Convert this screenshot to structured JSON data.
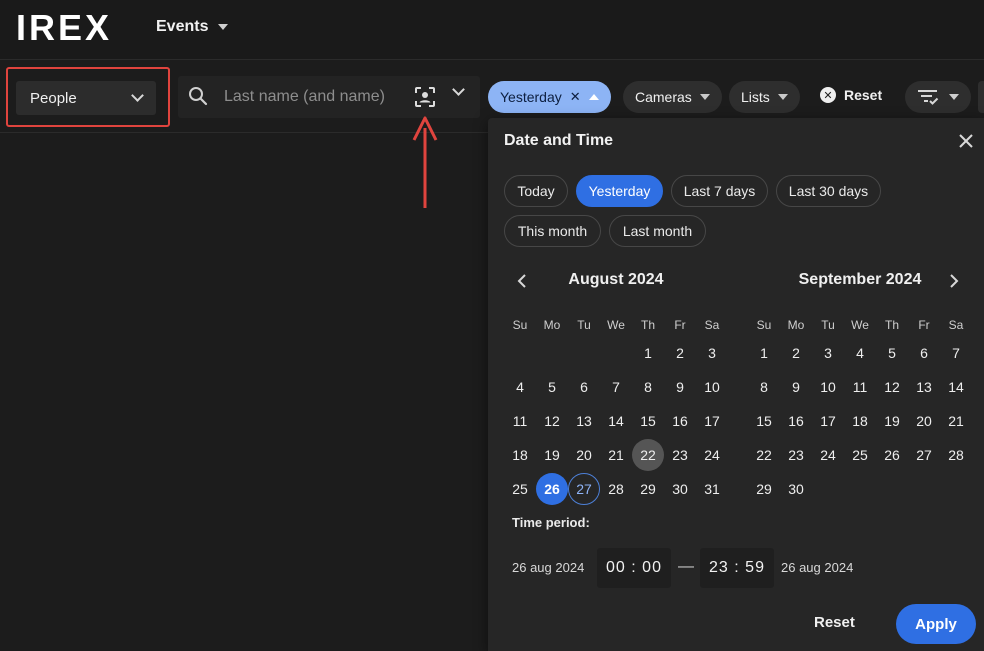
{
  "app": {
    "logo": "IREX",
    "nav_label": "Events"
  },
  "filterbar": {
    "object_type": "People",
    "search_placeholder": "Last name (and name)",
    "chips": {
      "date": "Yesterday",
      "cameras": "Cameras",
      "lists": "Lists"
    },
    "reset_label": "Reset"
  },
  "panel": {
    "title": "Date and Time",
    "presets": [
      "Today",
      "Yesterday",
      "Last 7 days",
      "Last 30 days",
      "This month",
      "Last month"
    ],
    "selected_preset": "Yesterday",
    "weekdays": [
      "Su",
      "Mo",
      "Tu",
      "We",
      "Th",
      "Fr",
      "Sa"
    ],
    "months": [
      {
        "title": "August 2024",
        "first_weekday": 4,
        "days": 31
      },
      {
        "title": "September 2024",
        "first_weekday": 0,
        "days": 30
      }
    ],
    "highlight_today": 22,
    "range_start": 26,
    "range_end": 27,
    "time_period_label": "Time period:",
    "start_date": "26 aug 2024",
    "start_time": "00 : 00",
    "dash": "—",
    "end_time": "23 : 59",
    "end_date": "26 aug 2024",
    "reset_label": "Reset",
    "apply_label": "Apply"
  },
  "colors": {
    "accent": "#2f6fe3",
    "annotation": "#e0443e"
  }
}
